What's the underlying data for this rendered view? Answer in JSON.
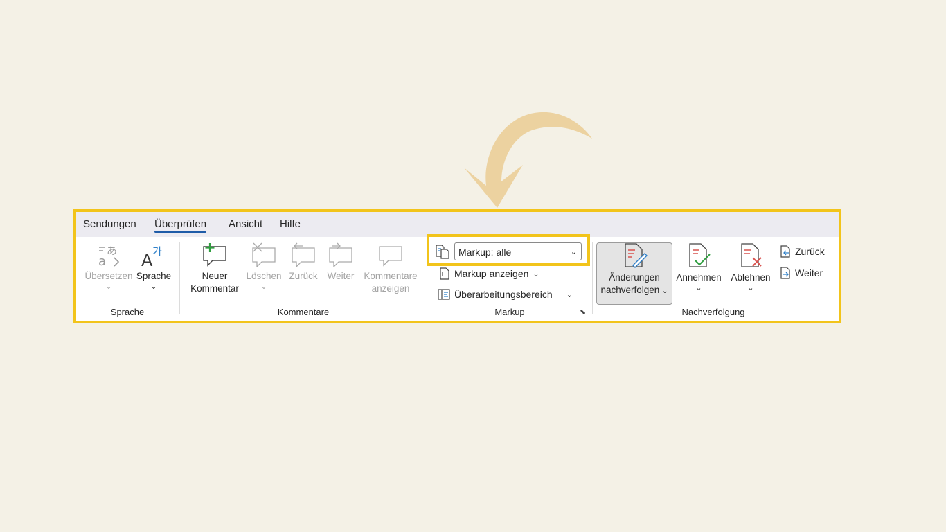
{
  "tabs": [
    "Sendungen",
    "Überprüfen",
    "Ansicht",
    "Hilfe"
  ],
  "groups": {
    "sprache": {
      "label": "Sprache",
      "translate": "Übersetzen",
      "language": "Sprache"
    },
    "kommentare": {
      "label": "Kommentare",
      "new_line1": "Neuer",
      "new_line2": "Kommentar",
      "delete": "Löschen",
      "back": "Zurück",
      "next": "Weiter",
      "show_line1": "Kommentare",
      "show_line2": "anzeigen"
    },
    "markup": {
      "label": "Markup",
      "select_value": "Markup: alle",
      "show_markup": "Markup anzeigen",
      "review_pane": "Überarbeitungsbereich"
    },
    "nachverfolgung": {
      "label": "Nachverfolgung",
      "track_line1": "Änderungen",
      "track_line2": "nachverfolgen",
      "accept": "Annehmen",
      "reject": "Ablehnen",
      "back": "Zurück",
      "next": "Weiter"
    }
  },
  "colors": {
    "highlight": "#f2c41b",
    "background": "#f4f1e6",
    "arrow": "#ecd2a0",
    "accent_tab": "#1f5ca8"
  },
  "icons": [
    "translate-icon",
    "language-icon",
    "new-comment-icon",
    "delete-comment-icon",
    "previous-comment-icon",
    "next-comment-icon",
    "show-comments-icon",
    "markup-display-icon",
    "show-markup-icon",
    "review-pane-icon",
    "track-changes-icon",
    "accept-icon",
    "reject-icon",
    "previous-change-icon",
    "next-change-icon",
    "curved-arrow-icon"
  ]
}
